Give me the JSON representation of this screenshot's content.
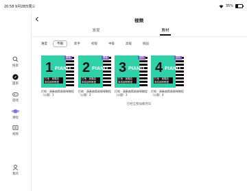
{
  "status": {
    "time": "20:58",
    "date": "9月28日周三",
    "battery": "35%",
    "battery_level": 0.35
  },
  "sidebar": {
    "items": [
      {
        "label": "搜索",
        "icon": "search-icon",
        "active": false
      },
      {
        "label": "首页",
        "icon": "compass-icon",
        "active": true
      },
      {
        "label": "游戏",
        "icon": "gamepad-icon",
        "active": false
      },
      {
        "label": "课程",
        "icon": "planet-icon",
        "active": false
      },
      {
        "label": "视频",
        "icon": "video-icon",
        "active": false
      },
      {
        "label": "我的",
        "icon": "user-icon",
        "active": false
      }
    ]
  },
  "header": {
    "title": "视频",
    "back_icon": "back-icon"
  },
  "tabs": [
    {
      "label": "发现",
      "active": false
    },
    {
      "label": "教材",
      "active": true
    }
  ],
  "filter": {
    "label": "难度",
    "options": [
      "不限",
      "新手",
      "初级",
      "中级",
      "高级",
      "挑战"
    ],
    "selected": "不限"
  },
  "cards": [
    {
      "number": "1",
      "tag": "基础",
      "caption": "打地 · 演奏曲\n简易钢琴教程",
      "title": "打地 · 演奏曲简易钢琴教程（公版）1"
    },
    {
      "number": "2",
      "tag": "基础",
      "caption": "打地 · 演奏曲\n简易钢琴教程",
      "title": "打地 · 演奏曲简易钢琴教程（公版）2"
    },
    {
      "number": "3",
      "tag": "进阶",
      "caption": "打地 · 演奏曲\n简易钢琴教程",
      "title": "打地 · 演奏曲简易钢琴教程（公版）3"
    },
    {
      "number": "4",
      "tag": "进阶",
      "caption": "打地 · 演奏曲\n简易钢琴教程",
      "title": "打地 · 演奏曲简易钢琴教程（公版）4"
    }
  ],
  "card_brand": "PIANO",
  "footer_text": "已经全部加载完毕",
  "colors": {
    "accent": "#2fd1a9",
    "tag": "#7e57c2"
  }
}
